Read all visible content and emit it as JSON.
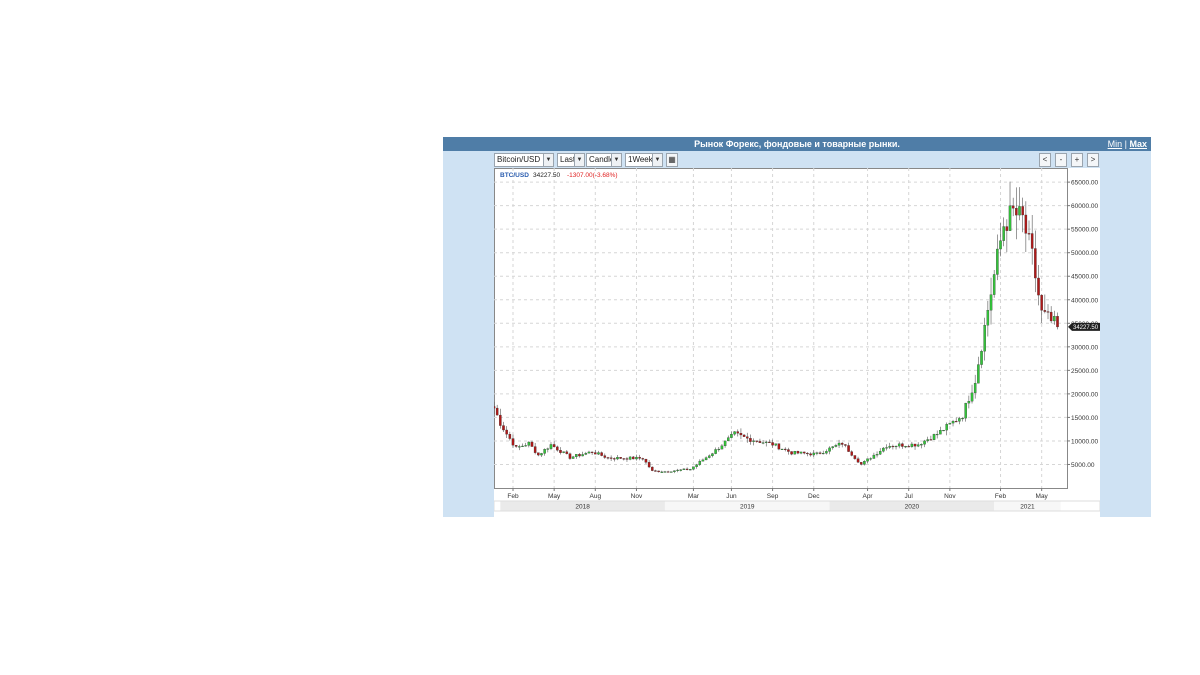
{
  "widget": {
    "title": "Рынок Форекс, фондовые и товарные рынки.",
    "min_label": "Min",
    "separator": "|",
    "max_label": "Max"
  },
  "toolbar": {
    "symbol": "Bitcoin/USD",
    "price_type": "Last",
    "chart_type": "Candle",
    "interval": "1Week",
    "nav": [
      "<",
      "-",
      "+",
      ">"
    ],
    "dropdown_icon": "triangle-down-icon",
    "settings_icon": "grid-icon"
  },
  "quote": {
    "symbol": "BTC/USD",
    "last": "34227.50",
    "change": "-1307.00(-3.68%)",
    "last_badge": "34227.50",
    "symbol_color": "#2a5db0",
    "change_color": "#e02020"
  },
  "colors": {
    "up": "#33c33a",
    "down": "#b01818",
    "wick": "#555555",
    "grid": "#d6d6d6"
  },
  "chart_data": {
    "type": "candlestick",
    "title": "",
    "xlabel": "",
    "ylabel": "",
    "interval": "1Week",
    "ylim": [
      0,
      68000
    ],
    "y_ticks": [
      5000,
      10000,
      15000,
      20000,
      25000,
      30000,
      35000,
      40000,
      45000,
      50000,
      55000,
      60000,
      65000
    ],
    "y_tick_labels": [
      "5000.00",
      "10000.00",
      "15000.00",
      "20000.00",
      "25000.00",
      "30000.00",
      "35000.00",
      "40000.00",
      "45000.00",
      "50000.00",
      "55000.00",
      "60000.00",
      "65000.00"
    ],
    "x_tick_labels": [
      {
        "label": "Feb",
        "week": 4
      },
      {
        "label": "May",
        "week": 17
      },
      {
        "label": "Aug",
        "week": 30
      },
      {
        "label": "Nov",
        "week": 43
      },
      {
        "label": "Mar",
        "week": 61
      },
      {
        "label": "Jun",
        "week": 73
      },
      {
        "label": "Sep",
        "week": 86
      },
      {
        "label": "Dec",
        "week": 99
      },
      {
        "label": "Apr",
        "week": 116
      },
      {
        "label": "Jul",
        "week": 129
      },
      {
        "label": "Nov",
        "week": 142
      },
      {
        "label": "Feb",
        "week": 158
      },
      {
        "label": "May",
        "week": 171
      }
    ],
    "years": [
      {
        "label": "2018",
        "start": 0,
        "end": 52
      },
      {
        "label": "2019",
        "start": 52,
        "end": 104
      },
      {
        "label": "2020",
        "start": 104,
        "end": 156
      },
      {
        "label": "2021",
        "start": 156,
        "end": 177
      }
    ],
    "grid": true,
    "key_points": [
      {
        "week": -2,
        "close": 17000
      },
      {
        "week": 0,
        "close": 13800
      },
      {
        "week": 2,
        "close": 11500
      },
      {
        "week": 5,
        "close": 8500
      },
      {
        "week": 9,
        "close": 9500
      },
      {
        "week": 12,
        "close": 7000
      },
      {
        "week": 16,
        "close": 9200
      },
      {
        "week": 22,
        "close": 6500
      },
      {
        "week": 29,
        "close": 7700
      },
      {
        "week": 34,
        "close": 6400
      },
      {
        "week": 45,
        "close": 6300
      },
      {
        "week": 48,
        "close": 3600
      },
      {
        "week": 52,
        "close": 3500
      },
      {
        "week": 60,
        "close": 4000
      },
      {
        "week": 68,
        "close": 8000
      },
      {
        "week": 74,
        "close": 11500
      },
      {
        "week": 78,
        "close": 10500
      },
      {
        "week": 86,
        "close": 9300
      },
      {
        "week": 92,
        "close": 7500
      },
      {
        "week": 100,
        "close": 7200
      },
      {
        "week": 108,
        "close": 9500
      },
      {
        "week": 114,
        "close": 5000
      },
      {
        "week": 122,
        "close": 9000
      },
      {
        "week": 132,
        "close": 9300
      },
      {
        "week": 138,
        "close": 11500
      },
      {
        "week": 146,
        "close": 15500
      },
      {
        "week": 150,
        "close": 23000
      },
      {
        "week": 154,
        "close": 38000
      },
      {
        "week": 159,
        "close": 56000
      },
      {
        "week": 162,
        "close": 58500
      },
      {
        "week": 165,
        "close": 57000
      },
      {
        "week": 168,
        "close": 49000
      },
      {
        "week": 171,
        "close": 37000
      },
      {
        "week": 176,
        "close": 34227.5
      }
    ]
  }
}
